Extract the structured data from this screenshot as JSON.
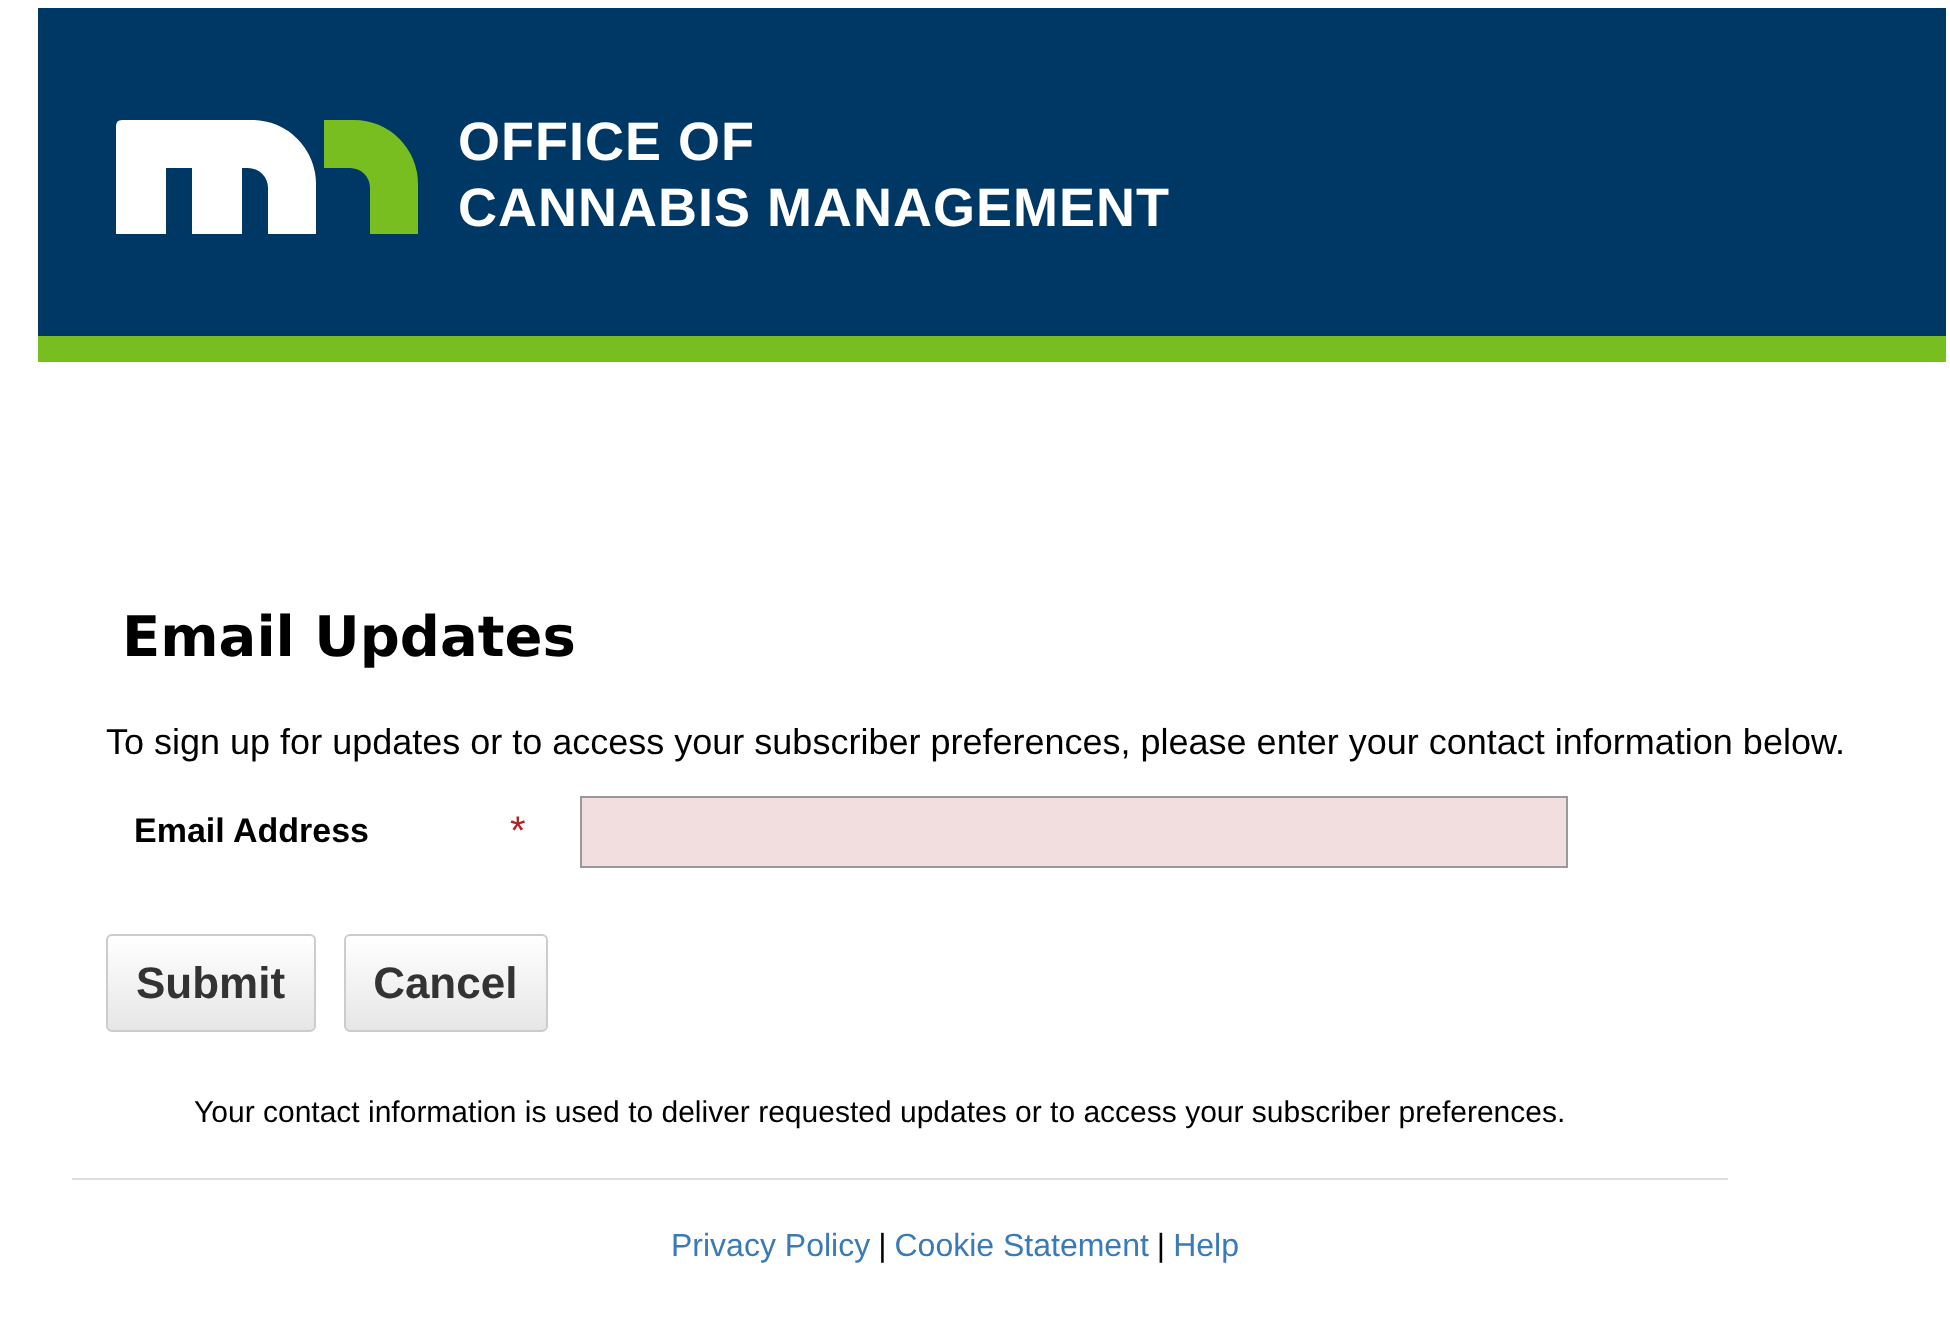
{
  "header": {
    "title_line_1": "OFFICE OF",
    "title_line_2": "CANNABIS MANAGEMENT"
  },
  "heading": "Email Updates",
  "intro": "To sign up for updates or to access your subscriber preferences, please enter your contact information below.",
  "email_field": {
    "label": "Email Address",
    "required": true,
    "required_mark": "*"
  },
  "buttons": [
    "Submit",
    "Cancel"
  ],
  "notice": "Your contact information is used to deliver requested updates or to access your subscriber preferences.",
  "footer_links": [
    {
      "label": "Privacy Policy"
    },
    {
      "label": "Cookie Statement"
    },
    {
      "label": "Help"
    }
  ],
  "footer_separator": "|"
}
